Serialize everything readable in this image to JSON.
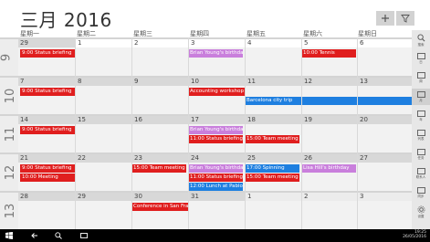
{
  "header": {
    "title": "三月 2016",
    "add_label": "+",
    "filter_label": "▽"
  },
  "weekdays": [
    "星期一",
    "星期二",
    "星期三",
    "星期四",
    "星期五",
    "星期六",
    "星期日"
  ],
  "weeks": [
    {
      "number": "9",
      "dates": [
        "29",
        "1",
        "2",
        "3",
        "4",
        "5",
        "6"
      ],
      "events": [
        {
          "text": "9:00 Status briefing",
          "color": "#e01e1e"
        },
        {
          "text": "Brian Young's birthday",
          "color": "#c97fdc"
        },
        {
          "text": "10:00 Tennis",
          "color": "#e01e1e"
        }
      ]
    },
    {
      "number": "10",
      "dates": [
        "7",
        "8",
        "9",
        "10",
        "11",
        "12",
        "13"
      ],
      "events": [
        {
          "text": "9:00 Status briefing",
          "color": "#e01e1e"
        },
        {
          "text": "Accounting workshop",
          "color": "#e01e1e"
        },
        {
          "text": "Barcelona city trip",
          "color": "#1e7fe0"
        }
      ]
    },
    {
      "number": "11",
      "dates": [
        "14",
        "15",
        "16",
        "17",
        "18",
        "19",
        "20"
      ],
      "events": [
        {
          "text": "9:00 Status briefing",
          "color": "#e01e1e"
        },
        {
          "text": "Brian Young's birthday",
          "color": "#c97fdc"
        },
        {
          "text": "11:00 Status briefing",
          "color": "#e01e1e"
        },
        {
          "text": "15:00 Team meeting",
          "color": "#e01e1e"
        }
      ]
    },
    {
      "number": "12",
      "dates": [
        "21",
        "22",
        "23",
        "24",
        "25",
        "26",
        "27"
      ],
      "events": [
        {
          "text": "9:00 Status briefing",
          "color": "#e01e1e"
        },
        {
          "text": "15:00 Team meeting",
          "color": "#e01e1e"
        },
        {
          "text": "Brian Young's birthday",
          "color": "#c97fdc"
        },
        {
          "text": "17:00 Spinning",
          "color": "#1e7fe0"
        },
        {
          "text": "Lisa Hill's birthday",
          "color": "#c97fdc"
        },
        {
          "text": "10:00 Meeting",
          "color": "#e01e1e"
        },
        {
          "text": "11:00 Status briefing",
          "color": "#e01e1e"
        },
        {
          "text": "15:00 Team meeting",
          "color": "#e01e1e"
        },
        {
          "text": "12:00 Lunch at Pablo's",
          "color": "#1e7fe0"
        }
      ]
    },
    {
      "number": "13",
      "dates": [
        "28",
        "29",
        "30",
        "31",
        "1",
        "2",
        "3"
      ],
      "events": [
        {
          "text": "Conference in San Francisco",
          "color": "#e01e1e"
        }
      ]
    }
  ],
  "side_pane": {
    "items": [
      {
        "label": "搜索",
        "icon": "search-icon"
      },
      {
        "label": "日",
        "icon": "day-view-icon"
      },
      {
        "label": "周",
        "icon": "week-view-icon"
      },
      {
        "label": "月",
        "icon": "month-view-icon"
      },
      {
        "label": "年",
        "icon": "year-view-icon"
      },
      {
        "label": "列表",
        "icon": "list-view-icon"
      },
      {
        "label": "任务",
        "icon": "tasks-icon"
      },
      {
        "label": "联系人",
        "icon": "contacts-icon"
      },
      {
        "label": "同步",
        "icon": "sync-icon"
      },
      {
        "label": "设置",
        "icon": "settings-icon"
      }
    ]
  },
  "taskbar": {
    "time": "19:25",
    "date": "26/05/2016"
  }
}
